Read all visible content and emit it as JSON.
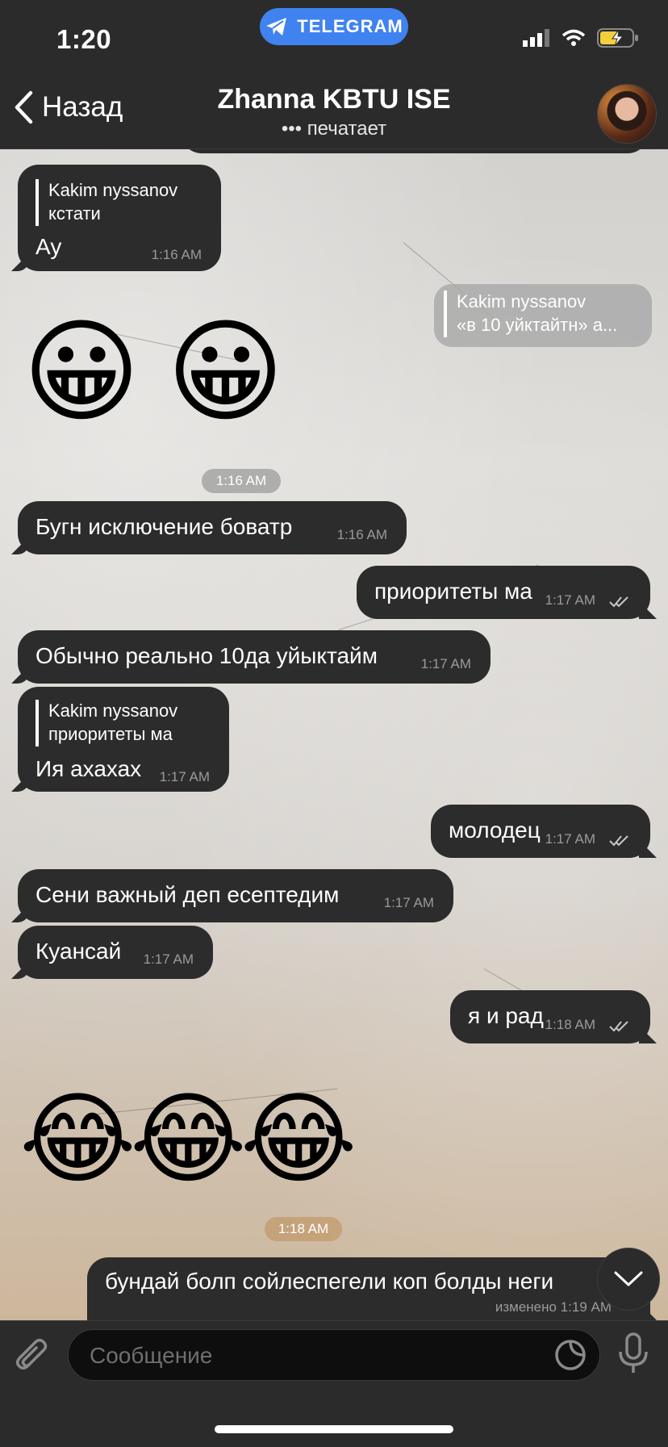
{
  "status": {
    "time": "1:20",
    "pill_label": "TELEGRAM"
  },
  "header": {
    "back_label": "Назад",
    "title": "Zhanna KBTU ISE",
    "subtitle": "••• печатает"
  },
  "messages": {
    "m1": {
      "reply_name": "Kakim nyssanov",
      "reply_text": "кстати",
      "text": "Ау",
      "time": "1:16 AM"
    },
    "m2": {
      "reply_name": "Kakim nyssanov",
      "reply_text": "«в 10 уйктайтн» а..."
    },
    "emoji1": "😀 😀",
    "date1": "1:16 AM",
    "m3": {
      "text": "Бугн исключение боватр",
      "time": "1:16 AM"
    },
    "m4": {
      "text": "приоритеты ма",
      "time": "1:17 AM"
    },
    "m5": {
      "text": "Обычно реально 10да уйыктайм",
      "time": "1:17 AM"
    },
    "m6": {
      "reply_name": "Kakim nyssanov",
      "reply_text": "приоритеты ма",
      "text": "Ия ахахах",
      "time": "1:17 AM"
    },
    "m7": {
      "text": "молодец",
      "time": "1:17 AM"
    },
    "m8": {
      "text": "Сени важный деп есептедим",
      "time": "1:17 AM"
    },
    "m9": {
      "text": "Куансай",
      "time": "1:17 AM"
    },
    "m10": {
      "text": "я и рад",
      "time": "1:18 AM"
    },
    "emoji2": "😂😂😂",
    "date2": "1:18 AM",
    "m11": {
      "text": "бундай болп сойлеспегели коп болды неги",
      "time": "изменено 1:19 AM"
    }
  },
  "input": {
    "placeholder": "Сообщение"
  },
  "colors": {
    "bubble": "#2c2c2c",
    "accent": "#3f82f0",
    "bar": "#2b2b2b"
  }
}
